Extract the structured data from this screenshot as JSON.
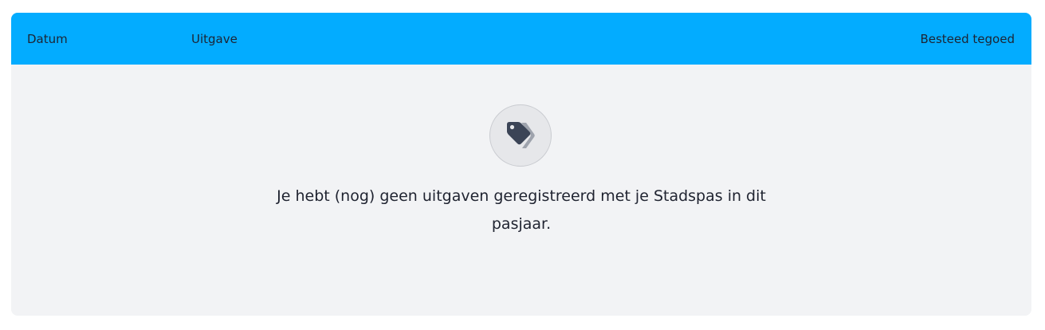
{
  "table": {
    "columns": [
      "Datum",
      "Uitgave",
      "Besteed tegoed"
    ]
  },
  "empty_state": {
    "icon": "tags-icon",
    "message": "Je hebt (nog) geen uitgaven geregistreerd met je Stadspas in dit pasjaar."
  },
  "colors": {
    "header_bg": "#03acff",
    "body_bg": "#f2f3f5",
    "icon_dark": "#3b4456",
    "icon_light": "#9ea3ad"
  }
}
